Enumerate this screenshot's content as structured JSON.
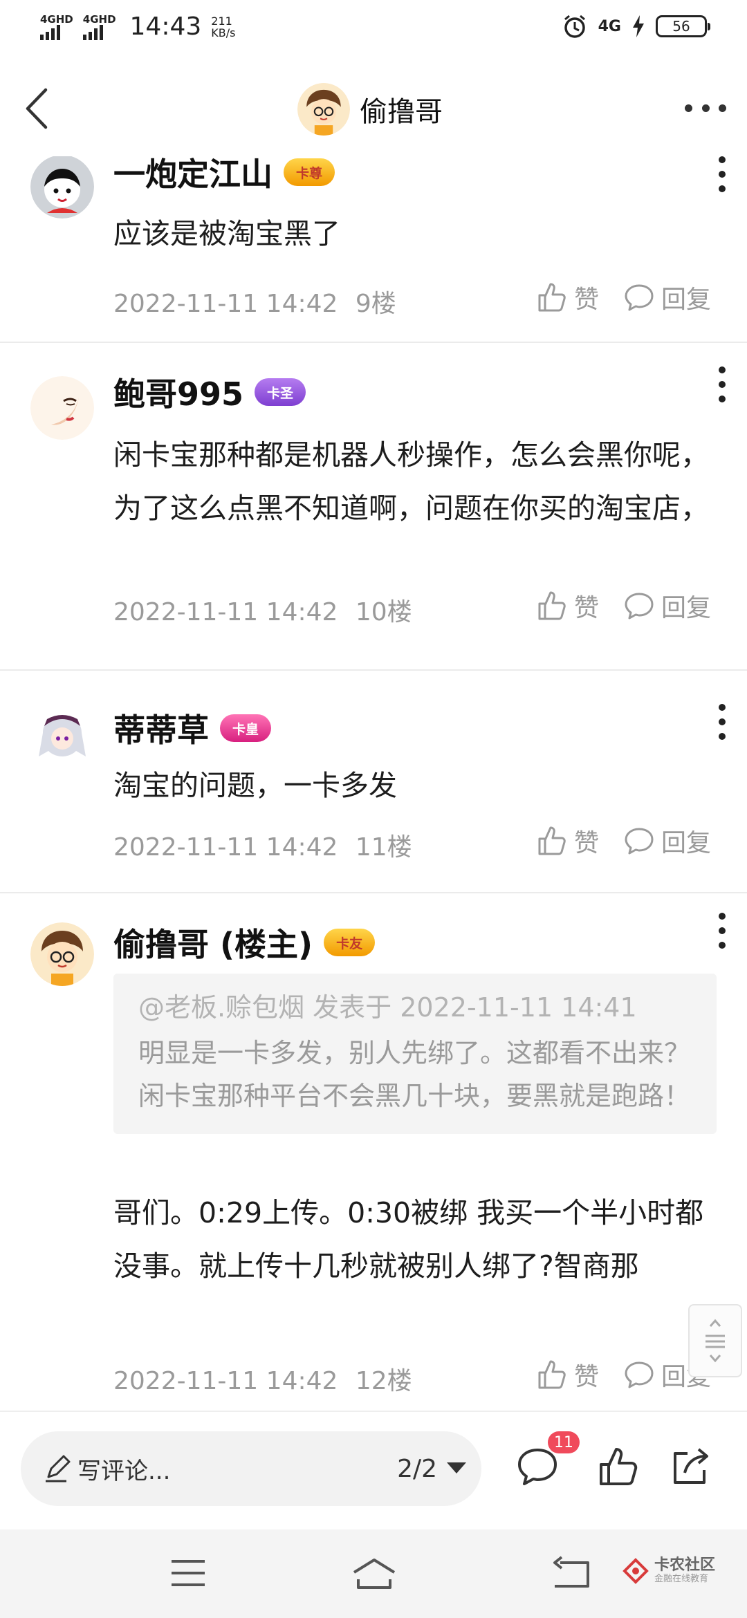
{
  "status_bar": {
    "sim1": "4GHD",
    "sim2": "4GHD",
    "time": "14:43",
    "speed_value": "211",
    "speed_unit": "KB/s",
    "network": "4G",
    "battery": "56"
  },
  "header": {
    "title": "偷撸哥"
  },
  "comments": [
    {
      "username": "一炮定江山",
      "badge": "卡尊",
      "text": "应该是被淘宝黑了",
      "time": "2022-11-11 14:42",
      "floor": "9楼"
    },
    {
      "username": "鲍哥995",
      "badge": "卡圣",
      "text": "闲卡宝那种都是机器人秒操作，怎么会黑你呢，为了这么点黑不知道啊，问题在你买的淘宝店，",
      "time": "2022-11-11 14:42",
      "floor": "10楼"
    },
    {
      "username": "蒂蒂草",
      "badge": "卡皇",
      "text": "淘宝的问题，一卡多发",
      "time": "2022-11-11 14:42",
      "floor": "11楼"
    },
    {
      "username": "偷撸哥 (楼主)",
      "badge": "卡友",
      "quote_head": "@老板.赊包烟 发表于 2022-11-11 14:41",
      "quote_body": "明显是一卡多发，别人先绑了。这都看不出来？闲卡宝那种平台不会黑几十块，要黑就是跑路！",
      "text": "哥们。0:29上传。0:30被绑 我买一个半小时都没事。就上传十几秒就被别人绑了?智商那",
      "time": "2022-11-11 14:42",
      "floor": "12楼"
    }
  ],
  "actions": {
    "like": "赞",
    "reply": "回复"
  },
  "bottom_bar": {
    "placeholder": "写评论...",
    "pages": "2/2",
    "comment_count": "11"
  },
  "watermark": {
    "title": "卡农社区",
    "subtitle": "金融在线教育"
  },
  "icons": {
    "like": "thumbs-up-icon",
    "reply": "speech-bubble-icon",
    "share": "share-icon",
    "more": "more-dots-icon"
  }
}
